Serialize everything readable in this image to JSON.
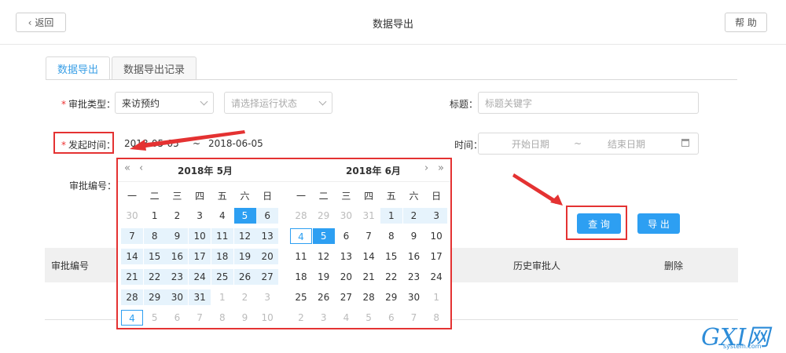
{
  "header": {
    "back_label": "返回",
    "title": "数据导出",
    "help_label": "帮 助"
  },
  "tabs": [
    {
      "label": "数据导出",
      "active": true
    },
    {
      "label": "数据导出记录",
      "active": false
    }
  ],
  "form": {
    "approval_type_label": "审批类型：",
    "approval_type_value": "来访预约",
    "status_placeholder": "请选择运行状态",
    "title_label": "标题：",
    "title_placeholder": "标题关键字",
    "start_time_label": "发起时间：",
    "start_date_value": "2018-05-05",
    "range_sep": "~",
    "end_date_value": "2018-06-05",
    "time_label": "时间：",
    "time_start_placeholder": "开始日期",
    "time_end_placeholder": "结束日期",
    "approval_no_label": "审批编号："
  },
  "buttons": {
    "query_label": "查 询",
    "export_label": "导 出"
  },
  "table": {
    "headers": [
      "审批编号",
      "历史审批人",
      "删除"
    ]
  },
  "calendar": {
    "left_title": "2018年 5月",
    "right_title": "2018年 6月",
    "weekdays": [
      "一",
      "二",
      "三",
      "四",
      "五",
      "六",
      "日"
    ],
    "left_days": [
      [
        "30",
        "1",
        "2",
        "3",
        "4",
        "5",
        "6"
      ],
      [
        "7",
        "8",
        "9",
        "10",
        "11",
        "12",
        "13"
      ],
      [
        "14",
        "15",
        "16",
        "17",
        "18",
        "19",
        "20"
      ],
      [
        "21",
        "22",
        "23",
        "24",
        "25",
        "26",
        "27"
      ],
      [
        "28",
        "29",
        "30",
        "31",
        "1",
        "2",
        "3"
      ],
      [
        "4",
        "5",
        "6",
        "7",
        "8",
        "9",
        "10"
      ]
    ],
    "right_days": [
      [
        "28",
        "29",
        "30",
        "31",
        "1",
        "2",
        "3"
      ],
      [
        "4",
        "5",
        "6",
        "7",
        "8",
        "9",
        "10"
      ],
      [
        "11",
        "12",
        "13",
        "14",
        "15",
        "16",
        "17"
      ],
      [
        "18",
        "19",
        "20",
        "21",
        "22",
        "23",
        "24"
      ],
      [
        "25",
        "26",
        "27",
        "28",
        "29",
        "30",
        "1"
      ],
      [
        "2",
        "3",
        "4",
        "5",
        "6",
        "7",
        "8"
      ]
    ]
  },
  "watermark": {
    "main": "GXI网",
    "sub": "system.com"
  },
  "colors": {
    "accent": "#2d9ff2",
    "highlight_red": "#e43232",
    "range_bg": "#e6f3fc"
  }
}
